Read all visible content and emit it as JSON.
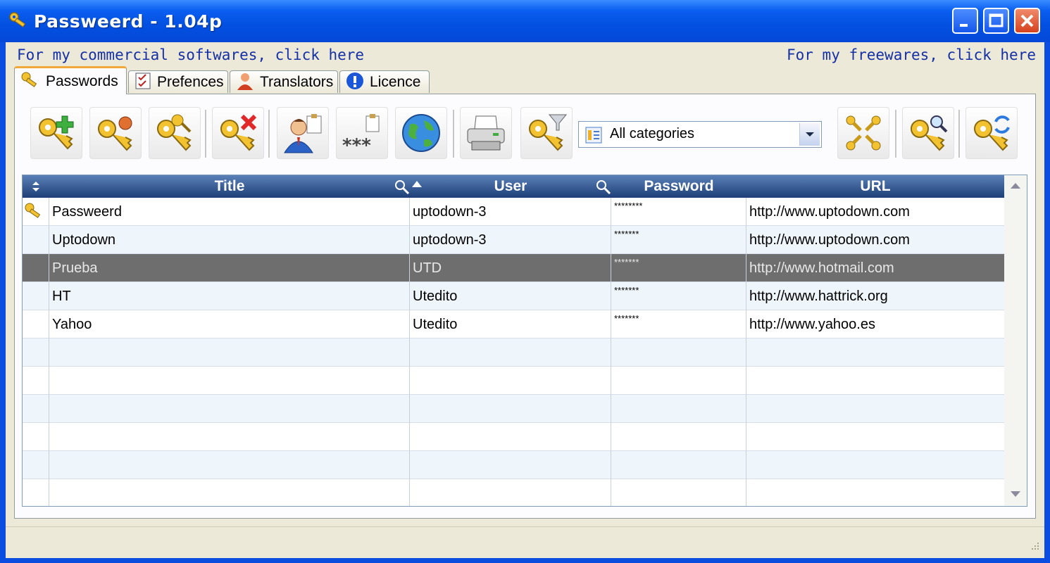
{
  "window": {
    "title": "Passweerd - 1.04p"
  },
  "links": {
    "commercial": "For my commercial softwares, click here",
    "freeware": "For my freewares, click here"
  },
  "tabs": [
    {
      "label": "Passwords",
      "icon": "keys-icon"
    },
    {
      "label": "Prefences",
      "icon": "checklist-icon"
    },
    {
      "label": "Translators",
      "icon": "user-icon"
    },
    {
      "label": "Licence",
      "icon": "info-icon"
    }
  ],
  "toolbar": {
    "buttons": [
      "add-key-icon",
      "edit-key-icon",
      "duplicate-key-icon",
      "delete-key-icon",
      "copy-user-icon",
      "copy-password-icon",
      "open-url-icon",
      "print-icon",
      "filter-key-icon",
      "keys-grid-icon",
      "search-key-icon",
      "refresh-key-icon"
    ],
    "category": {
      "value": "All categories"
    }
  },
  "grid": {
    "columns": [
      "Title",
      "User",
      "Password",
      "URL"
    ],
    "rows": [
      {
        "title": "Passweerd",
        "user": "uptodown-3",
        "password": "********",
        "url": "http://www.uptodown.com"
      },
      {
        "title": "Uptodown",
        "user": "uptodown-3",
        "password": "*******",
        "url": "http://www.uptodown.com"
      },
      {
        "title": "Prueba",
        "user": "UTD",
        "password": "*******",
        "url": "http://www.hotmail.com"
      },
      {
        "title": "HT",
        "user": "Utedito",
        "password": "*******",
        "url": "http://www.hattrick.org"
      },
      {
        "title": "Yahoo",
        "user": "Utedito",
        "password": "*******",
        "url": "http://www.yahoo.es"
      }
    ]
  },
  "colors": {
    "title_bar": "#0350e0",
    "header": "#2a4c88",
    "selected_row": "#6e6e6e",
    "link": "#1530a6"
  }
}
